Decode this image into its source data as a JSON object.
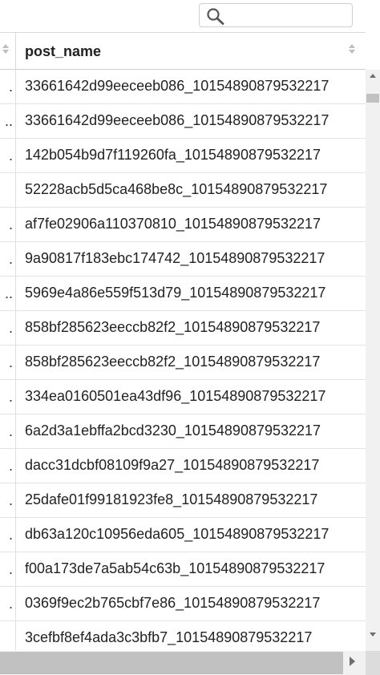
{
  "search": {
    "value": "",
    "icon": "search-icon"
  },
  "table": {
    "column_header": "post_name",
    "rows": [
      {
        "index_cell": ".",
        "post_name": "33661642d99eeceeb086_10154890879532217"
      },
      {
        "index_cell": "..",
        "post_name": "33661642d99eeceeb086_10154890879532217"
      },
      {
        "index_cell": ".",
        "post_name": "142b054b9d7f119260fa_10154890879532217"
      },
      {
        "index_cell": "",
        "post_name": "52228acb5d5ca468be8c_10154890879532217"
      },
      {
        "index_cell": ".",
        "post_name": "af7fe02906a110370810_10154890879532217"
      },
      {
        "index_cell": ".",
        "post_name": "9a90817f183ebc174742_10154890879532217"
      },
      {
        "index_cell": "..",
        "post_name": "5969e4a86e559f513d79_10154890879532217"
      },
      {
        "index_cell": ".",
        "post_name": "858bf285623eeccb82f2_10154890879532217"
      },
      {
        "index_cell": ".",
        "post_name": "858bf285623eeccb82f2_10154890879532217"
      },
      {
        "index_cell": ".",
        "post_name": "334ea0160501ea43df96_10154890879532217"
      },
      {
        "index_cell": ".",
        "post_name": "6a2d3a1ebffa2bcd3230_10154890879532217"
      },
      {
        "index_cell": ".",
        "post_name": "dacc31dcbf08109f9a27_10154890879532217"
      },
      {
        "index_cell": ".",
        "post_name": "25dafe01f99181923fe8_10154890879532217"
      },
      {
        "index_cell": ".",
        "post_name": "db63a120c10956eda605_10154890879532217"
      },
      {
        "index_cell": ".",
        "post_name": "f00a173de7a5ab54c63b_10154890879532217"
      },
      {
        "index_cell": ".",
        "post_name": "0369f9ec2b765cbf7e86_10154890879532217"
      },
      {
        "index_cell": "",
        "post_name": "3cefbf8ef4ada3c3bfb7_10154890879532217"
      }
    ]
  },
  "colors": {
    "header_bg": "#ffffff",
    "border": "#d9d9d9",
    "scrollbar_track": "#f1f1f1",
    "scrollbar_thumb": "#c1c1c1"
  }
}
